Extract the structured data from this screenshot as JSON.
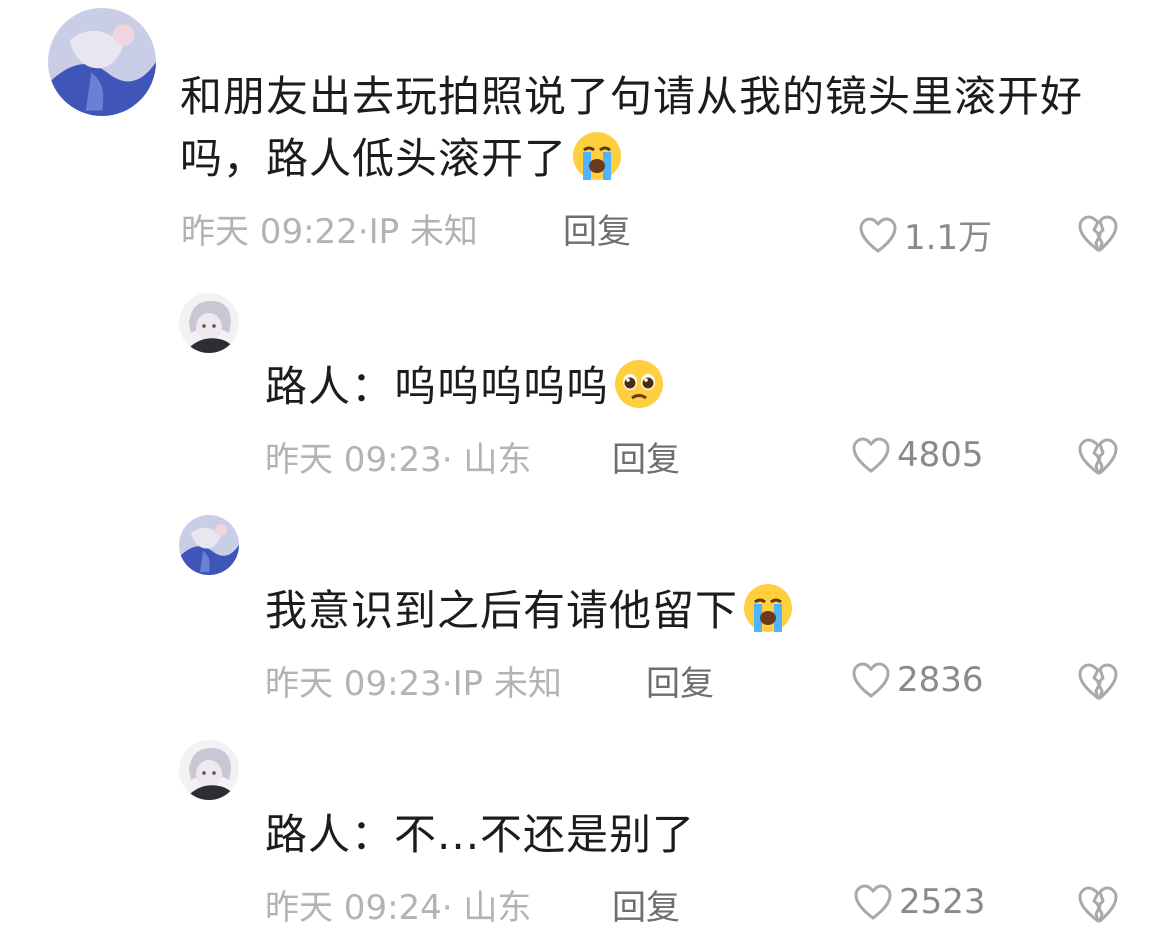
{
  "comments": [
    {
      "text": "和朋友出去玩拍照说了句请从我的镜头里滚开好吗，路人低头滚开了",
      "emoji": "loudly-crying-face",
      "meta": "昨天 09:22·IP 未知",
      "reply_label": "回复",
      "likes": "1.1万"
    },
    {
      "text": "路人：呜呜呜呜呜",
      "emoji": "pleading-face",
      "meta": "昨天 09:23· 山东",
      "reply_label": "回复",
      "likes": "4805"
    },
    {
      "text": "我意识到之后有请他留下",
      "emoji": "loudly-crying-face",
      "meta": "昨天 09:23·IP 未知",
      "reply_label": "回复",
      "likes": "2836"
    },
    {
      "text": "路人：不...不还是别了",
      "emoji": "",
      "meta": "昨天 09:24· 山东",
      "reply_label": "回复",
      "likes": "2523"
    }
  ],
  "icons": {
    "like": "heart-outline-icon",
    "dislike": "broken-heart-icon"
  },
  "colors": {
    "text": "#1c1c1c",
    "meta": "#b3b3b3",
    "reply": "#6e6e6e",
    "icon": "#a9a9a9"
  }
}
